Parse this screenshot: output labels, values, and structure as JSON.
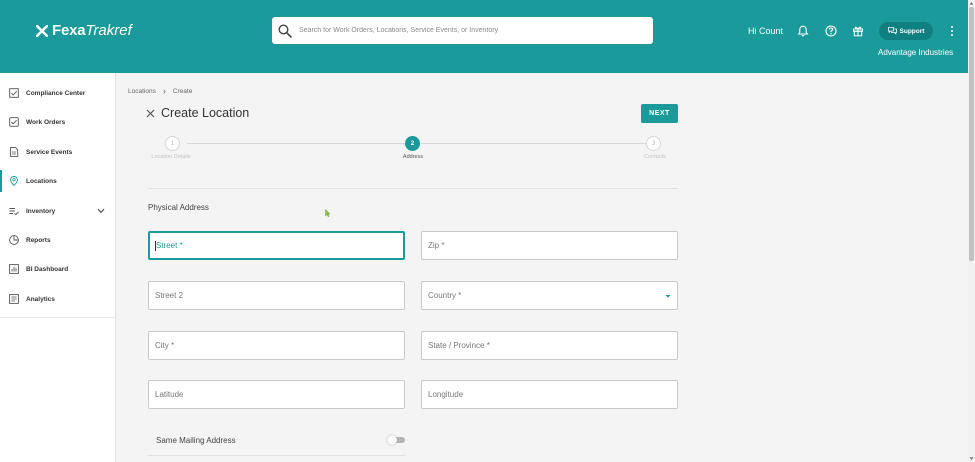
{
  "brand": {
    "bold": "Fexa",
    "light": "Trakref"
  },
  "search": {
    "placeholder": "Search for Work Orders, Locations, Service Events, or Inventory",
    "value": ""
  },
  "header": {
    "greeting": "Hi Count",
    "support_label": "Support",
    "company": "Advantage Industries"
  },
  "sidebar": {
    "items": [
      {
        "label": "Compliance Center",
        "icon": "compliance-icon"
      },
      {
        "label": "Work Orders",
        "icon": "work-orders-icon"
      },
      {
        "label": "Service Events",
        "icon": "service-events-icon"
      },
      {
        "label": "Locations",
        "icon": "location-pin-icon",
        "active": true
      },
      {
        "label": "Inventory",
        "icon": "inventory-icon"
      },
      {
        "label": "Reports",
        "icon": "reports-icon"
      },
      {
        "label": "BI Dashboard",
        "icon": "bi-dashboard-icon"
      },
      {
        "label": "Analytics",
        "icon": "analytics-icon"
      }
    ]
  },
  "breadcrumb": [
    "Locations",
    "Create"
  ],
  "page": {
    "title": "Create Location",
    "next_label": "NEXT"
  },
  "stepper": [
    {
      "number": "1",
      "label": "Location Details",
      "state": "inactive"
    },
    {
      "number": "2",
      "label": "Address",
      "state": "active"
    },
    {
      "number": "3",
      "label": "Contacts",
      "state": "inactive"
    }
  ],
  "form": {
    "section_title": "Physical Address",
    "street": "Street *",
    "zip": "Zip *",
    "street2": "Street 2",
    "country": "Country *",
    "city": "City *",
    "state": "State / Province *",
    "latitude": "Latitude",
    "longitude": "Longitude",
    "same_mailing": "Same Mailing Address",
    "same_mailing_on": false
  },
  "colors": {
    "accent": "#1a9a9a",
    "accent_dark": "#0f7f7f"
  }
}
